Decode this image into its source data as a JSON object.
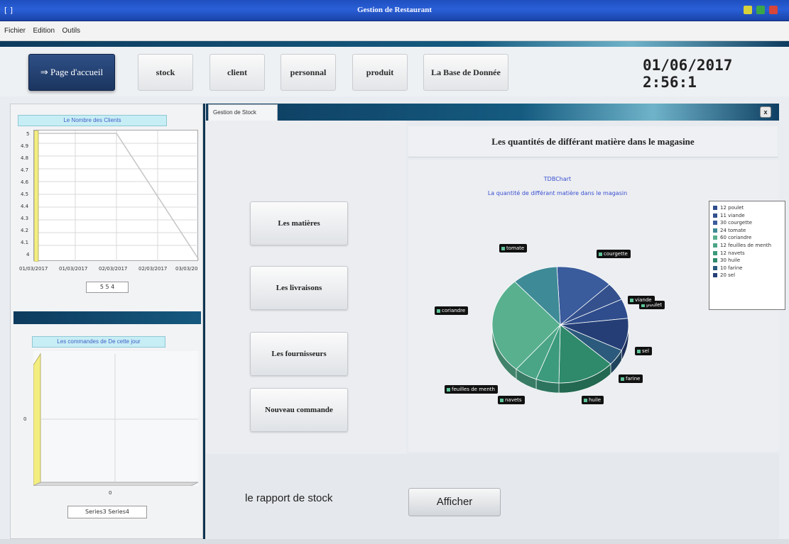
{
  "window": {
    "title": "Gestion de Restaurant"
  },
  "menu": [
    "Fichier",
    "Edition",
    "Outils"
  ],
  "nav": {
    "home": "Page d'accueil",
    "stock": "stock",
    "client": "client",
    "personnal": "personnal",
    "produit": "produit",
    "database": "La Base de Donnée"
  },
  "clock": "01/06/2017 2:56:1",
  "left": {
    "chart1": {
      "title": "Le Nombre des Clients",
      "yticks": [
        "5",
        "4.9",
        "4.8",
        "4.7",
        "4.6",
        "4.5",
        "4.4",
        "4.3",
        "4.2",
        "4.1",
        "4"
      ],
      "xticks": [
        "01/03/2017",
        "01/03/2017",
        "02/03/2017",
        "02/03/2017",
        "03/03/20"
      ],
      "legend": "5   5   4"
    },
    "chart2": {
      "title": "Les commandes  de De cette jour",
      "ytick": "0",
      "xtick": "0",
      "legend": "Series3   Series4"
    }
  },
  "tab": {
    "label": "Gestion de Stock",
    "close": "x"
  },
  "actions": [
    "Les matières",
    "Les livraisons",
    "Les fournisseurs",
    "Nouveau commande"
  ],
  "stock_chart": {
    "header": "Les quantités de différant matière dans le magasine",
    "tchart_label": "TDBChart",
    "subtitle": "La quantité de différant matière dans le magasin"
  },
  "chart_data": {
    "type": "pie",
    "categories": [
      "poulet",
      "viande",
      "courgette",
      "tomate",
      "coriandre",
      "feuilles de menth",
      "navets",
      "huile",
      "farine",
      "sel"
    ],
    "values": [
      12,
      11,
      30,
      24,
      60,
      12,
      12,
      30,
      10,
      20
    ],
    "colors": [
      "#2f4d8c",
      "#34518d",
      "#3a5b9c",
      "#3e8a97",
      "#58b08f",
      "#4aa586",
      "#3c9a7d",
      "#2e8a6a",
      "#2c5a7c",
      "#253f76"
    ]
  },
  "bottom": {
    "rapport": "le rapport de stock",
    "button": "Afficher"
  }
}
